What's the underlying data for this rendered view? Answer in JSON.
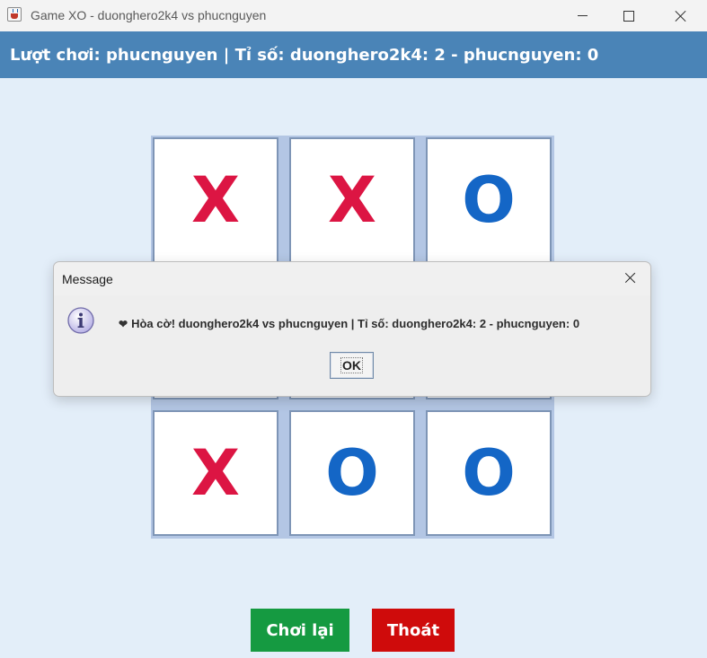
{
  "window": {
    "title": "Game XO - duonghero2k4 vs phucnguyen"
  },
  "status": {
    "text": "Lượt chơi: phucnguyen | Tỉ số: duonghero2k4: 2 - phucnguyen: 0"
  },
  "board": {
    "cells": [
      {
        "mark": "X"
      },
      {
        "mark": "X"
      },
      {
        "mark": "O"
      },
      {
        "mark": ""
      },
      {
        "mark": ""
      },
      {
        "mark": ""
      },
      {
        "mark": "X"
      },
      {
        "mark": "O"
      },
      {
        "mark": "O"
      }
    ],
    "colors": {
      "x": "#dc1543",
      "o": "#1466c6"
    }
  },
  "dialog": {
    "title": "Message",
    "message": "Hòa cờ! duonghero2k4 vs phucnguyen | Tỉ số: duonghero2k4: 2 - phucnguyen: 0",
    "message_icon": "heart-icon",
    "ok_label": "OK"
  },
  "actions": {
    "replay_label": "Chơi lại",
    "exit_label": "Thoát",
    "replay_color": "#159a41",
    "exit_color": "#cf0b0b"
  }
}
